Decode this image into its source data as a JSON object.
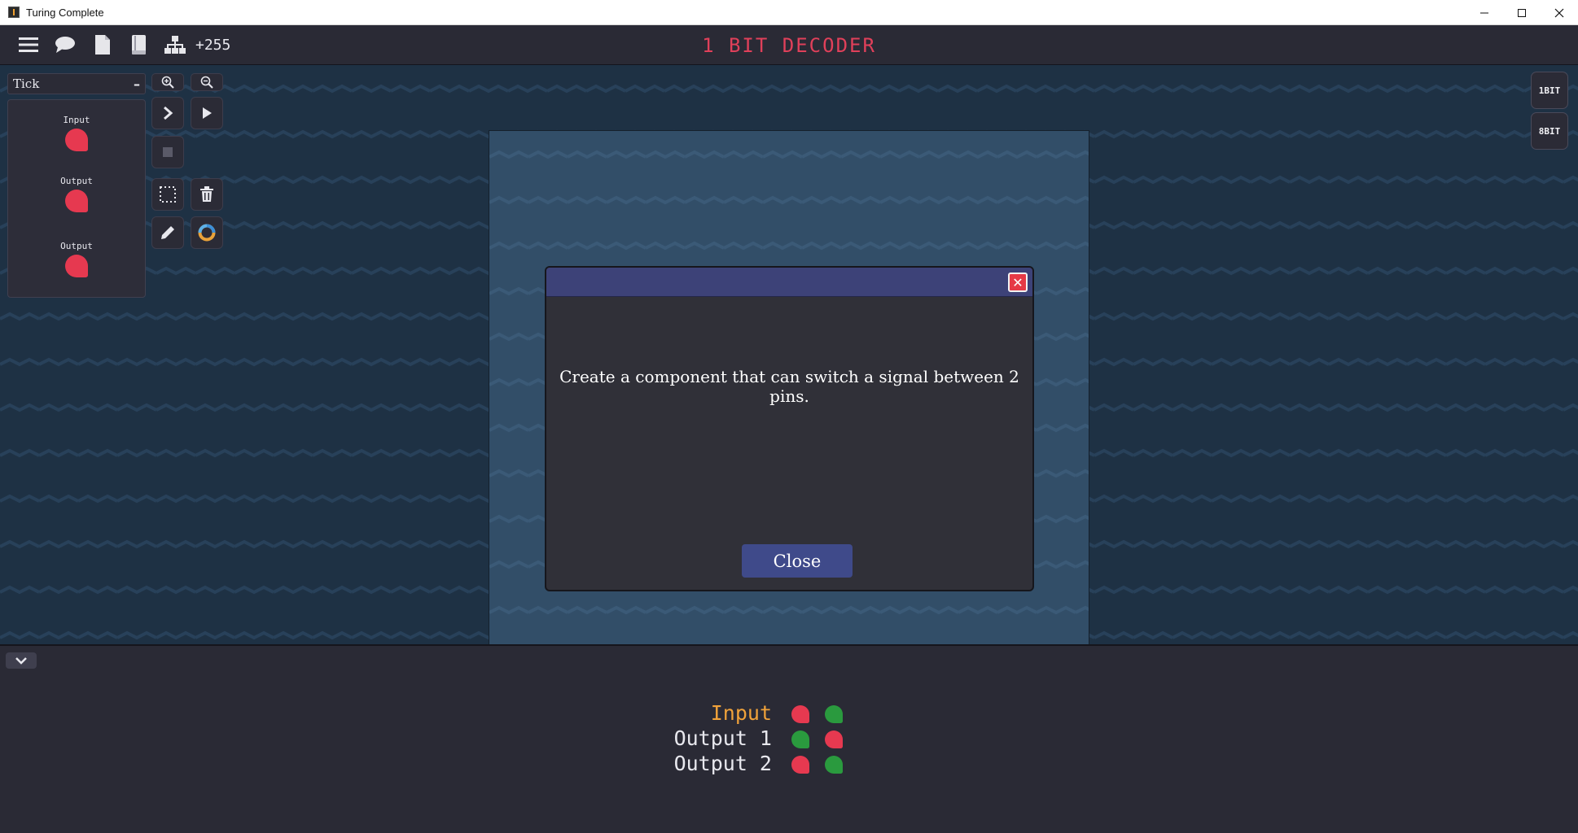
{
  "window": {
    "title": "Turing Complete",
    "controls": [
      "minimize-icon",
      "maximize-icon",
      "close-icon"
    ]
  },
  "topbar": {
    "icons": [
      "menu-icon",
      "chat-icon",
      "document-icon",
      "book-icon",
      "hierarchy-icon"
    ],
    "score": "+255",
    "level_title": "1 BIT DECODER"
  },
  "palette": {
    "header": "Tick",
    "collapse_symbol": "–",
    "components": [
      {
        "label": "Input"
      },
      {
        "label": "Output"
      },
      {
        "label": "Output"
      }
    ]
  },
  "tools": [
    "zoom-in-icon",
    "zoom-out-icon",
    "step-icon",
    "play-icon",
    "stop-icon",
    "select-icon",
    "trash-icon",
    "pencil-icon",
    "color-wheel-icon"
  ],
  "right_tabs": [
    "1BIT",
    "8BIT"
  ],
  "modal": {
    "message": "Create a component that can switch a signal between 2 pins.",
    "close_label": "Close"
  },
  "truth_table": {
    "rows": [
      {
        "name": "Input",
        "values": [
          "red",
          "green"
        ]
      },
      {
        "name": "Output 1",
        "values": [
          "green",
          "red"
        ]
      },
      {
        "name": "Output 2",
        "values": [
          "red",
          "green"
        ]
      }
    ]
  },
  "colors": {
    "title_red": "#e0405a",
    "pin_off": "#e63950",
    "pin_on": "#2a9a3e",
    "input_label": "#f0a23a",
    "modal_header": "#3d4278",
    "modal_button": "#3f4a8a"
  }
}
